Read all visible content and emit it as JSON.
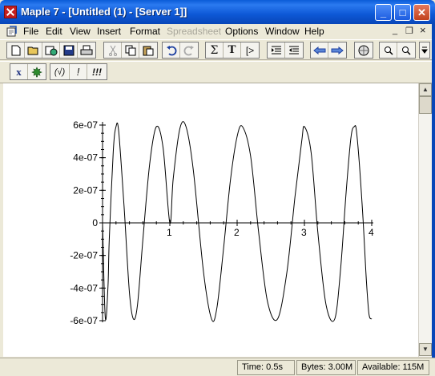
{
  "window": {
    "title": "Maple 7  - [Untitled (1) - [Server 1]]"
  },
  "titlebar_buttons": {
    "minimize": "_",
    "maximize": "□",
    "close": "✕"
  },
  "menu": {
    "items": [
      {
        "label": "File",
        "disabled": false
      },
      {
        "label": "Edit",
        "disabled": false
      },
      {
        "label": "View",
        "disabled": false
      },
      {
        "label": "Insert",
        "disabled": false
      },
      {
        "label": "Format",
        "disabled": false
      },
      {
        "label": "Spreadsheet",
        "disabled": true
      },
      {
        "label": "Options",
        "disabled": false
      },
      {
        "label": "Window",
        "disabled": false
      },
      {
        "label": "Help",
        "disabled": false
      }
    ],
    "mdi_minimize": "_",
    "mdi_restore": "❐",
    "mdi_close": "×"
  },
  "toolbar1": {
    "sigma": "Σ",
    "text": "T",
    "prompt": "[>"
  },
  "toolbar2": {
    "x_button": "x",
    "eval_button": "(√)",
    "exec_button": "!",
    "exec_all_button": "!!!"
  },
  "status": {
    "time": "Time:   0.5s",
    "bytes": "Bytes: 3.00M",
    "available": "Available: 115M"
  },
  "chart_data": {
    "type": "line",
    "x_ticks": [
      "1",
      "2",
      "3",
      "4"
    ],
    "y_ticks": [
      "6e-07",
      "4e-07",
      "2e-07",
      "0",
      "-2e-07",
      "-4e-07",
      "-6e-07"
    ],
    "xlim": [
      0,
      4
    ],
    "ylim": [
      -6e-07,
      6e-07
    ],
    "series": [
      {
        "color": "#000000",
        "x": [
          0.0,
          0.04,
          0.08,
          0.1,
          0.16,
          0.2,
          0.24,
          0.32,
          0.4,
          0.46,
          0.52,
          0.6,
          0.7,
          0.8,
          0.9,
          1.0,
          1.05,
          1.15,
          1.24,
          1.35,
          1.5,
          1.62,
          1.7,
          1.8,
          1.9,
          2.0,
          2.08,
          2.2,
          2.32,
          2.45,
          2.6,
          2.74,
          2.86,
          2.96,
          3.0,
          3.1,
          3.2,
          3.32,
          3.45,
          3.54,
          3.62,
          3.69,
          3.74,
          3.78,
          3.86,
          3.92,
          3.96,
          4.0
        ],
        "y": [
          0.0,
          -5.8e-07,
          -4e-07,
          -1e-07,
          4.4e-07,
          5.9e-07,
          5.6e-07,
          1e-07,
          -4.3e-07,
          -5.9e-07,
          -5e-07,
          -1e-07,
          3.6e-07,
          5.9e-07,
          4.6e-07,
          0.0,
          2.7e-07,
          5.8e-07,
          5.9e-07,
          3.2e-07,
          -3e-07,
          -5.9e-07,
          -5.2e-07,
          -1.5e-07,
          2.6e-07,
          5.3e-07,
          5.9e-07,
          4.1e-07,
          -6e-08,
          -4.8e-07,
          -5.9e-07,
          -3e-07,
          1.6e-07,
          5e-07,
          5.9e-07,
          4.3e-07,
          -6e-08,
          -5e-07,
          -5.9e-07,
          -2.7e-07,
          1.9e-07,
          5.2e-07,
          5.9e-07,
          5.4e-07,
          1e-07,
          -3.5e-07,
          -5.6e-07,
          -5.9e-07
        ]
      }
    ]
  }
}
